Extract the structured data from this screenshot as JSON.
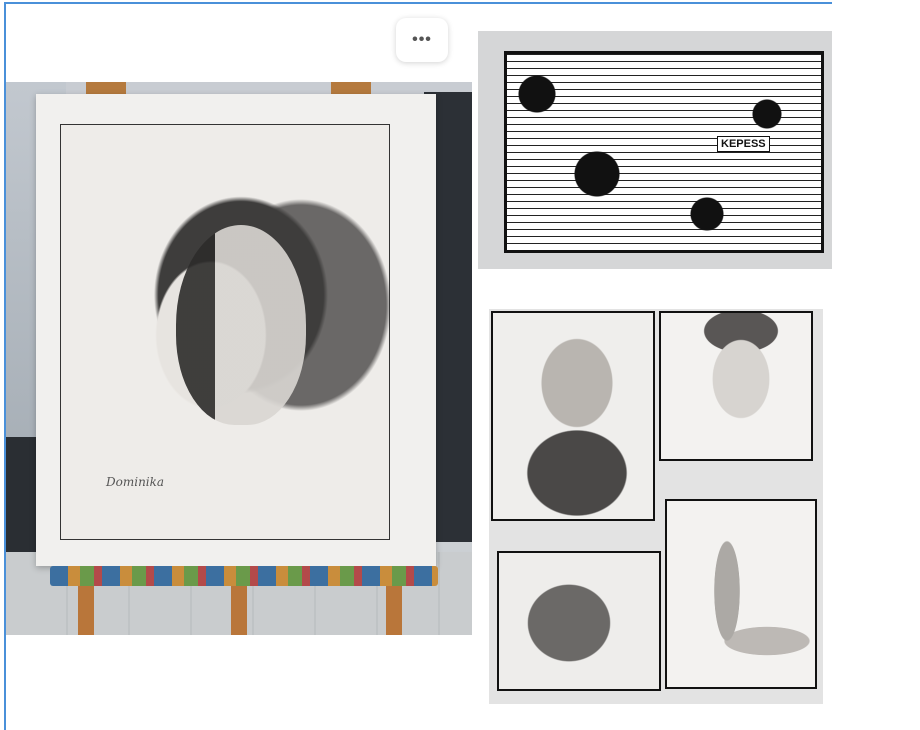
{
  "toolbar": {
    "more_button_label": "•••",
    "more_button_icon": "more-horizontal-icon"
  },
  "gallery": {
    "photos": [
      {
        "title_icon": "photo-icon",
        "subject": "easel-portrait-drawing",
        "signature": "Dominika"
      },
      {
        "title_icon": "photo-icon",
        "subject": "comic-collage-drawing",
        "label_text": "KEPESS"
      },
      {
        "title_icon": "photo-icon",
        "subject": "four-portrait-drawings"
      }
    ]
  },
  "colors": {
    "frame_accent": "#4a90d9"
  }
}
